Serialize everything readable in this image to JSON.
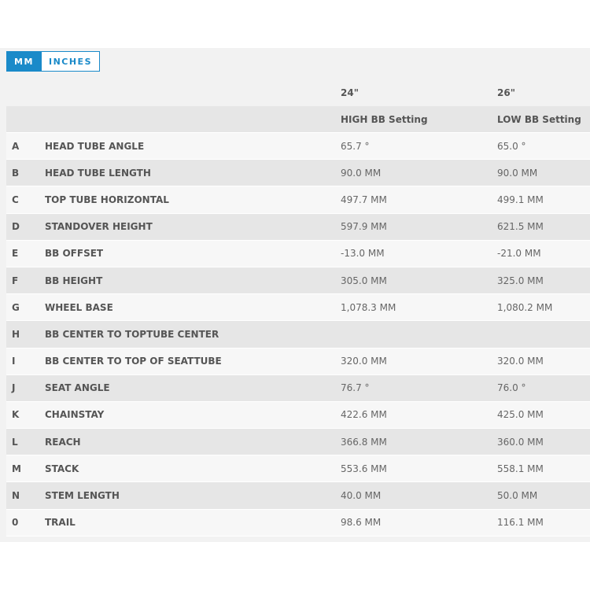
{
  "units": {
    "mm": "MM",
    "inches": "INCHES"
  },
  "columns": {
    "size1": "24\"",
    "size2": "26\"",
    "setting1": "HIGH BB Setting",
    "setting2": "LOW BB Setting"
  },
  "rows": [
    {
      "letter": "A",
      "name": "HEAD TUBE ANGLE",
      "v1": "65.7 °",
      "v2": "65.0 °"
    },
    {
      "letter": "B",
      "name": "HEAD TUBE LENGTH",
      "v1": "90.0 MM",
      "v2": "90.0 MM"
    },
    {
      "letter": "C",
      "name": "TOP TUBE HORIZONTAL",
      "v1": "497.7 MM",
      "v2": "499.1 MM"
    },
    {
      "letter": "D",
      "name": "STANDOVER HEIGHT",
      "v1": "597.9 MM",
      "v2": "621.5 MM"
    },
    {
      "letter": "E",
      "name": "BB OFFSET",
      "v1": "-13.0 MM",
      "v2": "-21.0 MM"
    },
    {
      "letter": "F",
      "name": "BB HEIGHT",
      "v1": "305.0 MM",
      "v2": "325.0 MM"
    },
    {
      "letter": "G",
      "name": "WHEEL BASE",
      "v1": "1,078.3 MM",
      "v2": "1,080.2 MM"
    },
    {
      "letter": "H",
      "name": "BB CENTER TO TOPTUBE CENTER",
      "v1": "",
      "v2": ""
    },
    {
      "letter": "I",
      "name": "BB CENTER TO TOP OF SEATTUBE",
      "v1": "320.0 MM",
      "v2": "320.0 MM"
    },
    {
      "letter": "J",
      "name": "SEAT ANGLE",
      "v1": "76.7 °",
      "v2": "76.0 °"
    },
    {
      "letter": "K",
      "name": "CHAINSTAY",
      "v1": "422.6 MM",
      "v2": "425.0 MM"
    },
    {
      "letter": "L",
      "name": "REACH",
      "v1": "366.8 MM",
      "v2": "360.0 MM"
    },
    {
      "letter": "M",
      "name": "STACK",
      "v1": "553.6 MM",
      "v2": "558.1 MM"
    },
    {
      "letter": "N",
      "name": "STEM LENGTH",
      "v1": "40.0 MM",
      "v2": "50.0 MM"
    },
    {
      "letter": "0",
      "name": "TRAIL",
      "v1": "98.6 MM",
      "v2": "116.1 MM"
    }
  ]
}
